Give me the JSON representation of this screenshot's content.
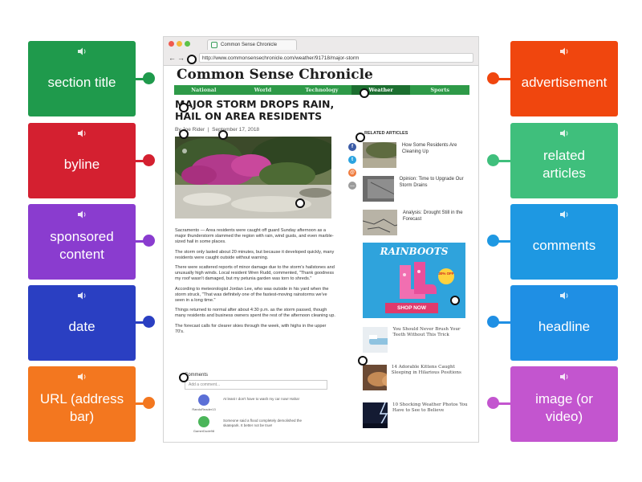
{
  "labels": [
    {
      "text": "section title",
      "color": "#1f9a4c",
      "dot": "#1f9a4c",
      "side": "left"
    },
    {
      "text": "byline",
      "color": "#d42030",
      "dot": "#d42030",
      "side": "left"
    },
    {
      "text": "sponsored content",
      "color": "#8a3ccf",
      "dot": "#8a3ccf",
      "side": "left"
    },
    {
      "text": "date",
      "color": "#2a3fc2",
      "dot": "#2a3fc2",
      "side": "left"
    },
    {
      "text": "URL (address bar)",
      "color": "#f3771f",
      "dot": "#f3771f",
      "side": "left"
    },
    {
      "text": "advertisement",
      "color": "#f0460e",
      "dot": "#f0460e",
      "side": "right"
    },
    {
      "text": "related articles",
      "color": "#3fbf7c",
      "dot": "#3fbf7c",
      "side": "right"
    },
    {
      "text": "comments",
      "color": "#1e98e2",
      "dot": "#1e98e2",
      "side": "right"
    },
    {
      "text": "headline",
      "color": "#1f8fe4",
      "dot": "#1f8fe4",
      "side": "right"
    },
    {
      "text": "image (or video)",
      "color": "#c355cf",
      "dot": "#c355cf",
      "side": "right"
    }
  ],
  "speaker_icon": "speaker-icon",
  "browser": {
    "tab_title": "Common Sense Chronicle",
    "back": "←",
    "forward": "→",
    "url": "http://www.commonsensechronicle.com/weather/91718/major-storm"
  },
  "page": {
    "masthead": "Common Sense Chronicle",
    "sections": [
      "National",
      "World",
      "Technology",
      "Weather",
      "Sports"
    ],
    "active_section": "Weather",
    "headline": "MAJOR STORM DROPS RAIN, HAIL ON AREA RESIDENTS",
    "byline": "By Joe Rider",
    "date": "September 17, 2018",
    "body": [
      "Sacramento — Area residents were caught off guard Sunday afternoon as a major thunderstorm slammed the region with rain, wind gusts, and even marble-sized hail in some places.",
      "The storm only lasted about 20 minutes, but because it developed quickly, many residents were caught outside without warning.",
      "There were scattered reports of minor damage due to the storm's hailstones and unusually high winds. Local resident Wren Rudd, commented, \"Thank goodness my roof wasn't damaged, but my petunia garden was torn to shreds.\"",
      "According to meteorologist Jordan Lee, who was outside in his yard when the storm struck, \"That was definitely one of the fastest-moving rainstorms we've seen in a long time.\"",
      "Things returned to normal after about 4:30 p.m. as the storm passed, though many residents and business owners spent the rest of the afternoon cleaning up.",
      "The forecast calls for clearer skies through the week, with highs in the upper 70's."
    ],
    "comments": {
      "heading": "Comments",
      "placeholder": "Add a comment...",
      "items": [
        {
          "user": "RandoReader13",
          "text": "At least I don't have to wash my car now! Haha!",
          "color": "#5b6fd6"
        },
        {
          "user": "GamerDude98",
          "text": "Someone said a flood completely demolished the skatepark. It better not be true!",
          "color": "#4bb55a"
        }
      ]
    },
    "related": {
      "heading": "RELATED ARTICLES",
      "items": [
        "How Some Residents Are Cleaning Up",
        "Opinion: Time to Upgrade Our Storm Drains",
        "Analysis: Drought Still in the Forecast"
      ]
    },
    "ad": {
      "title": "RAINBOOTS",
      "badge": "30% OFF",
      "cta": "SHOP NOW"
    },
    "sponsored": [
      "You Should Never Brush Your Teeth Without This Trick",
      "14 Adorable Kittens Caught Sleeping in Hilarious Positions",
      "10 Shocking Weather Photos You Have to See to Believe"
    ],
    "share_icons": [
      "facebook-icon",
      "twitter-icon",
      "email-icon",
      "more-icon"
    ]
  }
}
